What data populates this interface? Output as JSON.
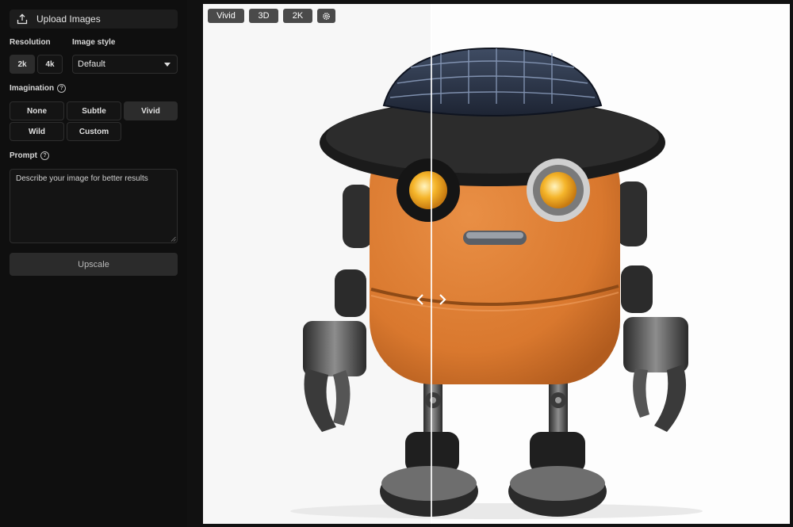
{
  "sidebar": {
    "upload_label": "Upload Images",
    "resolution": {
      "label": "Resolution",
      "options": [
        "2k",
        "4k"
      ],
      "selected": "2k"
    },
    "image_style": {
      "label": "Image style",
      "value": "Default"
    },
    "imagination": {
      "label": "Imagination",
      "options": [
        "None",
        "Subtle",
        "Vivid",
        "Wild",
        "Custom"
      ],
      "selected": "Vivid"
    },
    "prompt": {
      "label": "Prompt",
      "placeholder": "Describe your image for better results",
      "value": ""
    },
    "upscale_label": "Upscale"
  },
  "preview": {
    "tags": [
      "Vivid",
      "3D",
      "2K"
    ],
    "settings_icon": "gear-icon",
    "compare_handle_icons": [
      "chevron-left-icon",
      "chevron-right-icon"
    ]
  },
  "colors": {
    "background": "#0f0f0f",
    "active_button": "#2c2c2c",
    "tag_background": "#4a4a4a",
    "robot_body": "#d9782e"
  }
}
